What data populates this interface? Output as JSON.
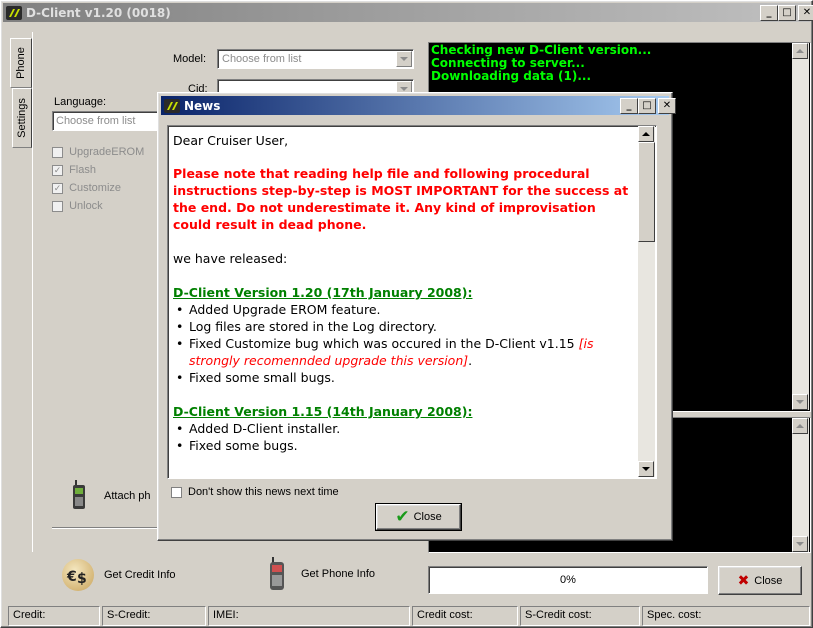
{
  "main_window": {
    "title": "D-Client v1.20 (0018)",
    "tabs": [
      "Phone",
      "Settings"
    ],
    "model_label": "Model:",
    "model_placeholder": "Choose from list",
    "cid_label": "Cid:",
    "language_label": "Language:",
    "language_placeholder": "Choose from list",
    "options": [
      {
        "label": "UpgradeEROM",
        "checked": false
      },
      {
        "label": "Flash",
        "checked": true
      },
      {
        "label": "Customize",
        "checked": true
      },
      {
        "label": "Unlock",
        "checked": false
      }
    ],
    "attach_label": "Attach ph",
    "log_lines": [
      "Checking new D-Client version...",
      "Connecting to server...",
      "Downloading data (1)..."
    ],
    "get_credit_label": "Get Credit Info",
    "get_phone_label": "Get Phone Info",
    "progress_text": "0%",
    "progress_value": 0,
    "close_label": "Close"
  },
  "status_bar": {
    "credit": "Credit:",
    "s_credit": "S-Credit:",
    "imei": "IMEI:",
    "credit_cost": "Credit cost:",
    "s_credit_cost": "S-Credit cost:",
    "spec_cost": "Spec. cost:"
  },
  "news_dialog": {
    "title": "News",
    "greeting": "Dear Cruiser User,",
    "warning": "Please note that reading help file and following procedural instructions step-by-step is MOST IMPORTANT for the success at the end. Do not underestimate it. Any kind of improvisation could result in dead phone.",
    "released": "we have released:",
    "sections": [
      {
        "heading": "D-Client Version 1.20 (17th January 2008):",
        "items": [
          {
            "text": "Added Upgrade EROM feature.",
            "note": ""
          },
          {
            "text": "Log files are stored in the Log directory.",
            "note": ""
          },
          {
            "text": "Fixed Customize bug which was occured in the D-Client v1.15 ",
            "note": "[is strongly recomennded upgrade this version]"
          },
          {
            "text": "Fixed some small bugs.",
            "note": ""
          }
        ]
      },
      {
        "heading": "D-Client Version 1.15 (14th January 2008):",
        "items": [
          {
            "text": "Added D-Client installer.",
            "note": ""
          },
          {
            "text": "Fixed some bugs.",
            "note": ""
          }
        ]
      }
    ],
    "dont_show_label": "Don't show this news next time",
    "close_label": "Close"
  }
}
